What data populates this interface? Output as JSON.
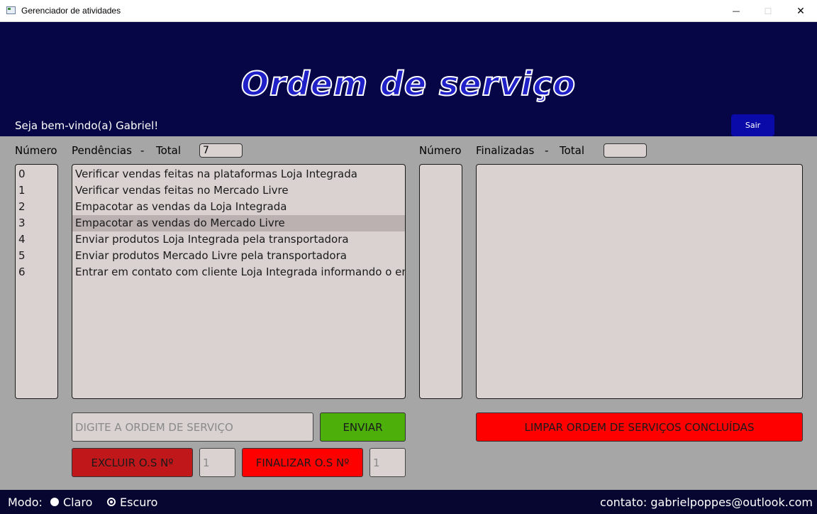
{
  "window": {
    "title": "Gerenciador de atividades",
    "minimize": "—",
    "maximize": "☐",
    "close": "✕"
  },
  "header": {
    "title": "Ordem de serviço",
    "welcome": "Seja bem-vindo(a) Gabriel!",
    "logout_label": "Sair"
  },
  "pending": {
    "number_label": "Número",
    "title_label": "Pendências",
    "dash": "-",
    "total_label": "Total",
    "total_value": "7",
    "numbers": [
      "0",
      "1",
      "2",
      "3",
      "4",
      "5",
      "6"
    ],
    "items": [
      "Verificar vendas feitas na plataformas Loja Integrada",
      "Verificar vendas feitas no Mercado Livre",
      "Empacotar as vendas da Loja Integrada",
      "Empacotar as vendas do Mercado Livre",
      "Enviar produtos Loja Integrada pela transportadora",
      "Enviar produtos Mercado Livre pela transportadora",
      "Entrar em contato com cliente Loja Integrada informando o envio"
    ],
    "selected_index": 3
  },
  "finished": {
    "number_label": "Número",
    "title_label": "Finalizadas",
    "dash": "-",
    "total_label": "Total",
    "total_value": "",
    "numbers": [],
    "items": []
  },
  "actions": {
    "order_placeholder": "DIGITE A ORDEM DE SERVIÇO",
    "send_label": "ENVIAR",
    "clear_label": "LIMPAR ORDEM DE SERVIÇOS CONCLUÍDAS",
    "delete_label": "EXCLUIR O.S Nº",
    "delete_value": "1",
    "finish_label": "FINALIZAR O.S Nº",
    "finish_value": "1"
  },
  "footer": {
    "mode_label": "Modo:",
    "light_label": "Claro",
    "dark_label": "Escuro",
    "selected_mode": "Escuro",
    "contact": "contato: gabrielpoppes@outlook.com"
  },
  "colors": {
    "header_bg": "#060646",
    "body_bg": "#a6a6a6",
    "send_green": "#4caf0a",
    "clear_red": "#ff0000",
    "delete_red": "#c0171a",
    "logout_blue": "#0a0aa8"
  }
}
